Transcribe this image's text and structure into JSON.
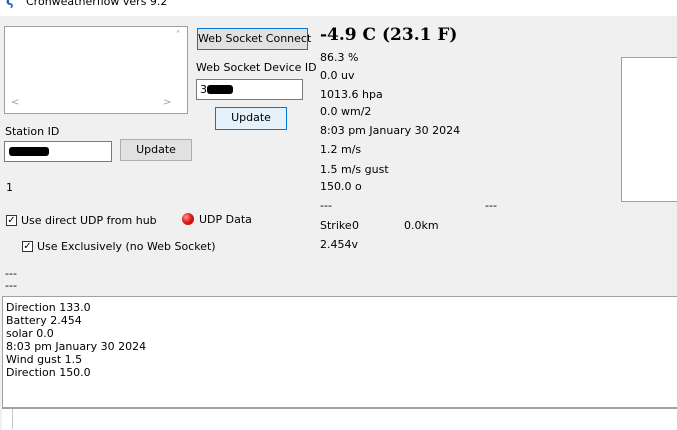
{
  "window": {
    "title": "Cronweatherflow vers 9.2",
    "icon": "app-logo-icon"
  },
  "listbox": {
    "scroll_up_icon": "chevron-up-icon",
    "scroll_left_icon": "chevron-left-icon",
    "scroll_right_icon": "chevron-right-icon"
  },
  "websocket": {
    "connect_label": "Web Socket Connect",
    "device_id_label": "Web Socket Device ID",
    "device_id_value": "3",
    "update_label": "Update"
  },
  "station": {
    "id_label": "Station ID",
    "update_label": "Update",
    "count": "1"
  },
  "udp": {
    "use_direct_label": "Use direct UDP from hub",
    "use_direct_checked": true,
    "use_exclusive_label": "Use Exclusively (no Web Socket)",
    "use_exclusive_checked": true,
    "status_label": "UDP Data",
    "status_color": "#e21b1b"
  },
  "readings": {
    "temperature": "-4.9 C (23.1 F)",
    "humidity": "86.3 %",
    "uv": "0.0 uv",
    "pressure": "1013.6 hpa",
    "solar": "0.0 wm/2",
    "time": "8:03 pm January 30 2024",
    "wind": "1.2 m/s",
    "gust": "1.5 m/s gust",
    "direction": "150.0 o",
    "dash1": "---",
    "dash2": "---",
    "strike_label": "Strike",
    "strike_count": "0",
    "strike_distance": "0.0km",
    "battery": "2.454v"
  },
  "left_dashes": [
    "---",
    "---"
  ],
  "log": [
    "Direction 133.0",
    "Battery 2.454",
    "solar 0.0",
    "8:03 pm January 30 2024",
    "Wind gust 1.5",
    "Direction 150.0"
  ]
}
